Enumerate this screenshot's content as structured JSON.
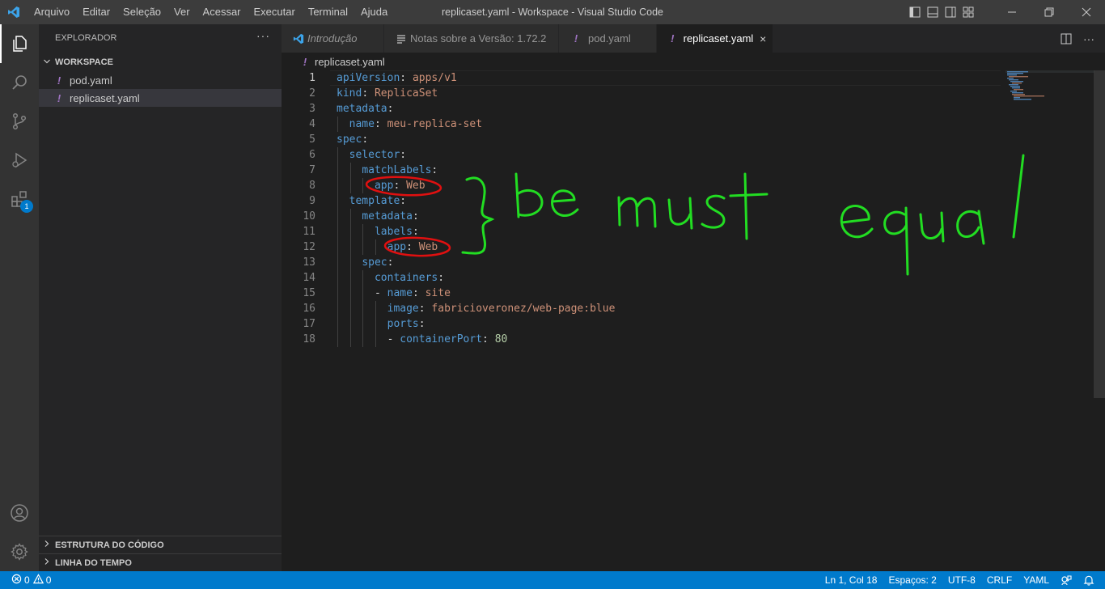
{
  "menu": [
    "Arquivo",
    "Editar",
    "Seleção",
    "Ver",
    "Acessar",
    "Executar",
    "Terminal",
    "Ajuda"
  ],
  "window_title": "replicaset.yaml - Workspace - Visual Studio Code",
  "sidebar": {
    "title": "EXPLORADOR",
    "more": "···",
    "workspace": "WORKSPACE",
    "files": [
      "pod.yaml",
      "replicaset.yaml"
    ],
    "outline": "ESTRUTURA DO CÓDIGO",
    "timeline": "LINHA DO TEMPO"
  },
  "activity": {
    "extensions_badge": "1"
  },
  "tabs": [
    {
      "label": "Introdução",
      "icon": "vscode-icon"
    },
    {
      "label": "Notas sobre a Versão: 1.72.2",
      "icon": "document-icon"
    },
    {
      "label": "pod.yaml",
      "icon": "yaml-icon"
    },
    {
      "label": "replicaset.yaml",
      "icon": "yaml-icon",
      "close": "×"
    }
  ],
  "breadcrumb": "replicaset.yaml",
  "editor": {
    "line_numbers": [
      "1",
      "2",
      "3",
      "4",
      "5",
      "6",
      "7",
      "8",
      "9",
      "10",
      "11",
      "12",
      "13",
      "14",
      "15",
      "16",
      "17",
      "18"
    ],
    "current_line": 1,
    "lines": [
      [
        {
          "t": "apiVersion",
          "c": "k"
        },
        {
          "t": ": ",
          "c": "p"
        },
        {
          "t": "apps/v1",
          "c": "s"
        }
      ],
      [
        {
          "t": "kind",
          "c": "k"
        },
        {
          "t": ": ",
          "c": "p"
        },
        {
          "t": "ReplicaSet",
          "c": "s"
        }
      ],
      [
        {
          "t": "metadata",
          "c": "k"
        },
        {
          "t": ":",
          "c": "p"
        }
      ],
      [
        {
          "t": "  "
        },
        {
          "t": "name",
          "c": "k"
        },
        {
          "t": ": ",
          "c": "p"
        },
        {
          "t": "meu-replica-set",
          "c": "s"
        }
      ],
      [
        {
          "t": "spec",
          "c": "k"
        },
        {
          "t": ":",
          "c": "p"
        }
      ],
      [
        {
          "t": "  "
        },
        {
          "t": "selector",
          "c": "k"
        },
        {
          "t": ":",
          "c": "p"
        }
      ],
      [
        {
          "t": "    "
        },
        {
          "t": "matchLabels",
          "c": "k"
        },
        {
          "t": ":",
          "c": "p"
        }
      ],
      [
        {
          "t": "      "
        },
        {
          "t": "app",
          "c": "k"
        },
        {
          "t": ": ",
          "c": "p"
        },
        {
          "t": "Web",
          "c": "s"
        }
      ],
      [
        {
          "t": "  "
        },
        {
          "t": "template",
          "c": "k"
        },
        {
          "t": ":",
          "c": "p"
        }
      ],
      [
        {
          "t": "    "
        },
        {
          "t": "metadata",
          "c": "k"
        },
        {
          "t": ":",
          "c": "p"
        }
      ],
      [
        {
          "t": "      "
        },
        {
          "t": "labels",
          "c": "k"
        },
        {
          "t": ":",
          "c": "p"
        }
      ],
      [
        {
          "t": "        "
        },
        {
          "t": "app",
          "c": "k"
        },
        {
          "t": ": ",
          "c": "p"
        },
        {
          "t": "Web",
          "c": "s"
        }
      ],
      [
        {
          "t": "    "
        },
        {
          "t": "spec",
          "c": "k"
        },
        {
          "t": ":",
          "c": "p"
        }
      ],
      [
        {
          "t": "      "
        },
        {
          "t": "containers",
          "c": "k"
        },
        {
          "t": ":",
          "c": "p"
        }
      ],
      [
        {
          "t": "      "
        },
        {
          "t": "- ",
          "c": "p"
        },
        {
          "t": "name",
          "c": "k"
        },
        {
          "t": ": ",
          "c": "p"
        },
        {
          "t": "site",
          "c": "s"
        }
      ],
      [
        {
          "t": "        "
        },
        {
          "t": "image",
          "c": "k"
        },
        {
          "t": ": ",
          "c": "p"
        },
        {
          "t": "fabricioveronez/web-page:blue",
          "c": "s"
        }
      ],
      [
        {
          "t": "        "
        },
        {
          "t": "ports",
          "c": "k"
        },
        {
          "t": ":",
          "c": "p"
        }
      ],
      [
        {
          "t": "        "
        },
        {
          "t": "- ",
          "c": "p"
        },
        {
          "t": "containerPort",
          "c": "k"
        },
        {
          "t": ": ",
          "c": "p"
        },
        {
          "t": "80",
          "c": "n"
        }
      ]
    ]
  },
  "annotation": {
    "text": "be must equal",
    "color": "#22dd22",
    "mark_color": "#e01010"
  },
  "status": {
    "errors": "0",
    "warnings": "0",
    "position": "Ln 1, Col 18",
    "spaces": "Espaços: 2",
    "encoding": "UTF-8",
    "eol": "CRLF",
    "language": "YAML"
  }
}
